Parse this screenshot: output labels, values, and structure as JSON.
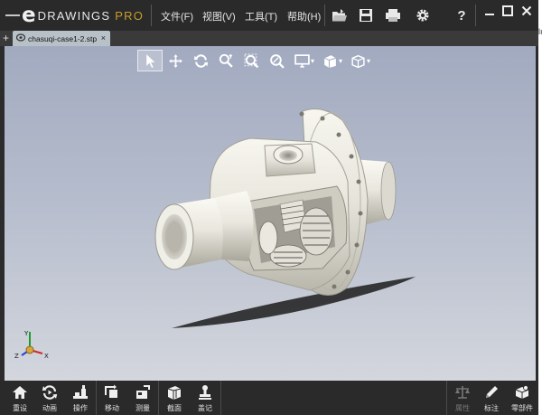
{
  "app": {
    "logo_letter": "e",
    "logo_word": "DRAWINGS",
    "logo_pro": "PRO"
  },
  "menu": [
    {
      "label": "文件(F)"
    },
    {
      "label": "视图(V)"
    },
    {
      "label": "工具(T)"
    },
    {
      "label": "帮助(H)"
    }
  ],
  "toolbar_icons": [
    "open-icon",
    "save-icon",
    "print-icon",
    "settings-icon",
    "help-icon"
  ],
  "help_label": "?",
  "window_controls": [
    "minimize-icon",
    "maximize-icon",
    "close-icon"
  ],
  "tabs": {
    "add_label": "+",
    "document": {
      "name": "chasuqi-case1-2.stp",
      "close_label": "×"
    }
  },
  "heads_up_toolbar": [
    {
      "name": "select-icon",
      "selected": true
    },
    {
      "name": "pan-icon"
    },
    {
      "name": "rotate-icon"
    },
    {
      "name": "zoom-icon"
    },
    {
      "name": "zoom-to-area-icon"
    },
    {
      "name": "zoom-to-fit-icon"
    },
    {
      "name": "display-style-icon",
      "dropdown": true
    },
    {
      "name": "section-view-icon",
      "dropdown": true
    },
    {
      "name": "view-orientation-icon",
      "dropdown": true
    }
  ],
  "triad": {
    "x": "X",
    "y": "Y",
    "z": "Z"
  },
  "bottom_left_tools": [
    {
      "icon": "home-icon",
      "label": "重设"
    },
    {
      "icon": "animate-icon",
      "label": "动画"
    },
    {
      "icon": "operate-icon",
      "label": "操作"
    },
    {
      "icon": "move-icon",
      "label": "移动"
    },
    {
      "icon": "measure-icon",
      "label": "测量"
    },
    {
      "icon": "section-icon",
      "label": "截面"
    },
    {
      "icon": "stamp-icon",
      "label": "盖记"
    }
  ],
  "bottom_right_tools": [
    {
      "icon": "properties-icon",
      "label": "属性",
      "enabled": false
    },
    {
      "icon": "markup-icon",
      "label": "标注",
      "enabled": true
    },
    {
      "icon": "components-icon",
      "label": "零部件",
      "enabled": true
    }
  ],
  "side_fragment": "lı",
  "colors": {
    "titlebar": "#2a2a2a",
    "viewport_top": "#a2aac0",
    "viewport_bottom": "#d3d6dd",
    "pro_accent": "#c89c2a",
    "model": "#eeece4"
  }
}
